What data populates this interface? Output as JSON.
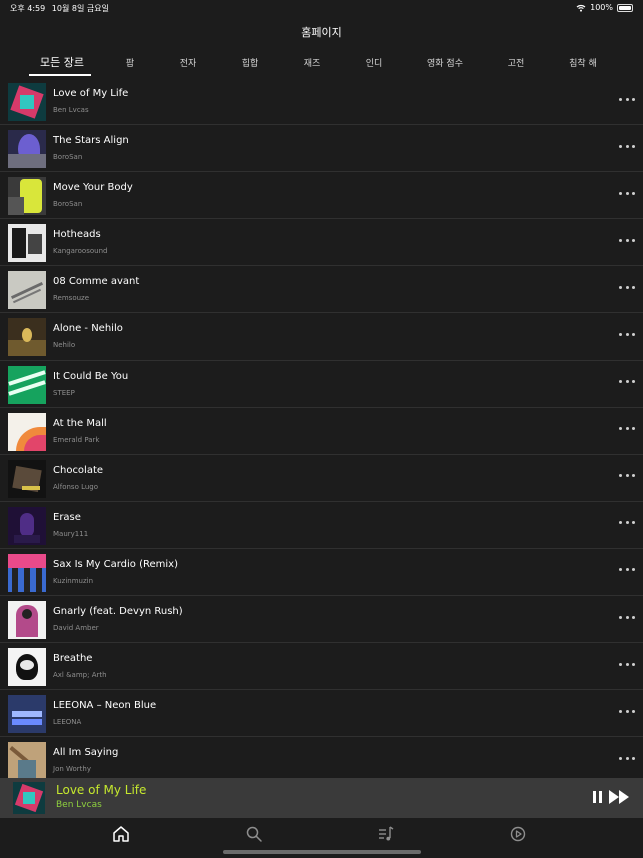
{
  "status": {
    "time": "오후 4:59",
    "date": "10월 8일 금요일",
    "battery": "100%"
  },
  "page_title": "홈페이지",
  "genres": [
    "모든 장르",
    "팝",
    "전자",
    "힙합",
    "재즈",
    "인디",
    "영화 점수",
    "고전",
    "침착 해"
  ],
  "tracks": [
    {
      "title": "Love of My Life",
      "artist": "Ben Lvcas"
    },
    {
      "title": "The Stars Align",
      "artist": "BoroSan"
    },
    {
      "title": "Move Your Body",
      "artist": "BoroSan"
    },
    {
      "title": "Hotheads",
      "artist": "Kangaroosound"
    },
    {
      "title": "08 Comme avant",
      "artist": "Remsouze"
    },
    {
      "title": "Alone - Nehilo",
      "artist": "Nehilo"
    },
    {
      "title": "It Could Be You",
      "artist": "STEEP"
    },
    {
      "title": "At the Mall",
      "artist": "Emerald Park"
    },
    {
      "title": "Chocolate",
      "artist": "Alfonso Lugo"
    },
    {
      "title": "Erase",
      "artist": "Maury111"
    },
    {
      "title": "Sax Is My Cardio (Remix)",
      "artist": "Kuzinmuzin"
    },
    {
      "title": "Gnarly (feat. Devyn Rush)",
      "artist": "David Amber"
    },
    {
      "title": "Breathe",
      "artist": "Axl &amp; Arth"
    },
    {
      "title": "LEEONA – Neon Blue",
      "artist": "LEEONA"
    },
    {
      "title": "All Im Saying",
      "artist": "Jon Worthy"
    }
  ],
  "now_playing": {
    "title": "Love of My Life",
    "artist": "Ben Lvcas"
  },
  "colors": {
    "background": "#1c1c1c",
    "accent_title": "#c5e82e",
    "accent_artist": "#8fd13f",
    "player_bg": "#3a3a3a"
  },
  "tab_bar_icons": [
    "home-icon",
    "search-icon",
    "playlist-icon",
    "history-icon"
  ]
}
